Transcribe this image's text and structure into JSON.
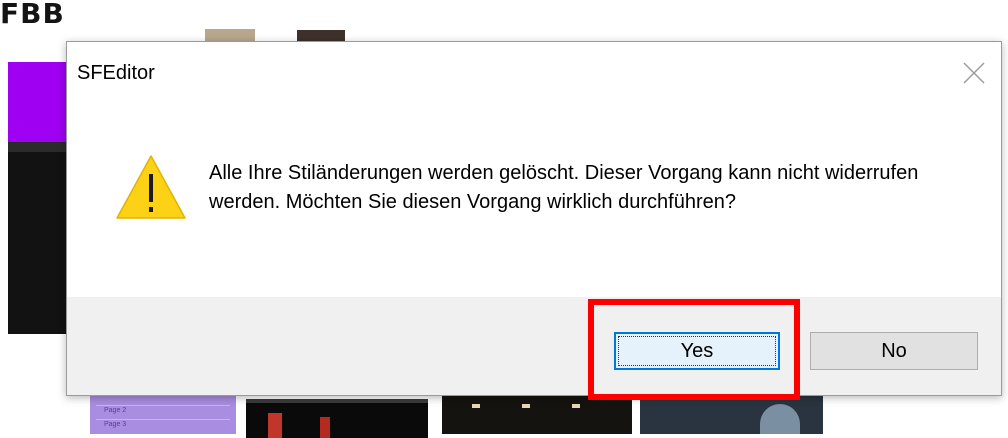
{
  "background": {
    "app_fragment_text": "FBB",
    "sidebar_page_labels": [
      "Page 2",
      "Page 3"
    ]
  },
  "dialog": {
    "title": "SFEditor",
    "close_icon": "close-icon",
    "warning_icon": "warning-triangle-icon",
    "message": "Alle Ihre Stiländerungen werden gelöscht. Dieser Vorgang kann nicht widerrufen werden. Möchten Sie diesen Vorgang wirklich durchführen?",
    "buttons": {
      "yes_label": "Yes",
      "no_label": "No"
    },
    "highlight_color": "#ff0000",
    "focus_color": "#0078d7"
  }
}
